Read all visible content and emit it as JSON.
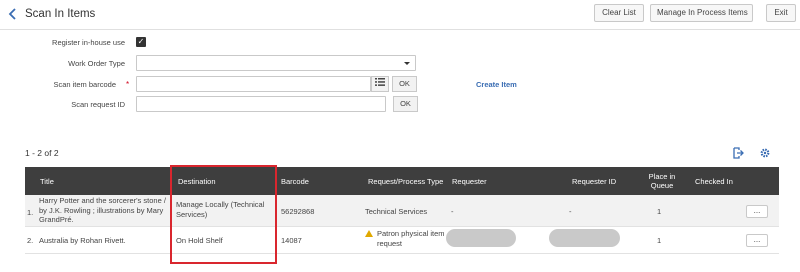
{
  "header": {
    "title": "Scan In Items",
    "buttons": {
      "clear_list": "Clear List",
      "manage_in_process": "Manage In Process Items",
      "exit": "Exit"
    }
  },
  "form": {
    "register_in_house": {
      "label": "Register in-house use",
      "checked": true
    },
    "work_order_type": {
      "label": "Work Order Type",
      "value": ""
    },
    "scan_item_barcode": {
      "label": "Scan item barcode",
      "required_mark": "*",
      "value": "",
      "ok": "OK"
    },
    "scan_request_id": {
      "label": "Scan request ID",
      "value": "",
      "ok": "OK"
    },
    "create_item": "Create Item"
  },
  "results": {
    "count_text": "1 - 2 of 2",
    "columns": {
      "title": "Title",
      "destination": "Destination",
      "barcode": "Barcode",
      "request_process_type": "Request/Process Type",
      "requester": "Requester",
      "requester_id": "Requester ID",
      "place_in_queue": "Place in Queue",
      "checked_in": "Checked In"
    },
    "rows": [
      {
        "num": "1.",
        "title": "Harry Potter and the sorcerer's stone / by J.K. Rowling ; illustrations by Mary GrandPré.",
        "destination": "Manage Locally (Technical Services)",
        "barcode": "56292868",
        "request_process_type": "Technical Services",
        "requester": "-",
        "requester_id": "-",
        "place_in_queue": "1",
        "checked_in": "",
        "actions": "..."
      },
      {
        "num": "2.",
        "title": "Australia by Rohan Rivett.",
        "destination": "On Hold Shelf",
        "barcode": "14087",
        "request_process_type": "Patron physical item request",
        "requester": "",
        "requester_id": "",
        "place_in_queue": "1",
        "checked_in": "",
        "actions": "..."
      }
    ]
  },
  "colors": {
    "accent": "#3a6db3",
    "header_bg": "#3e3e3e",
    "highlight": "#d9262e",
    "warning": "#e0a800"
  }
}
